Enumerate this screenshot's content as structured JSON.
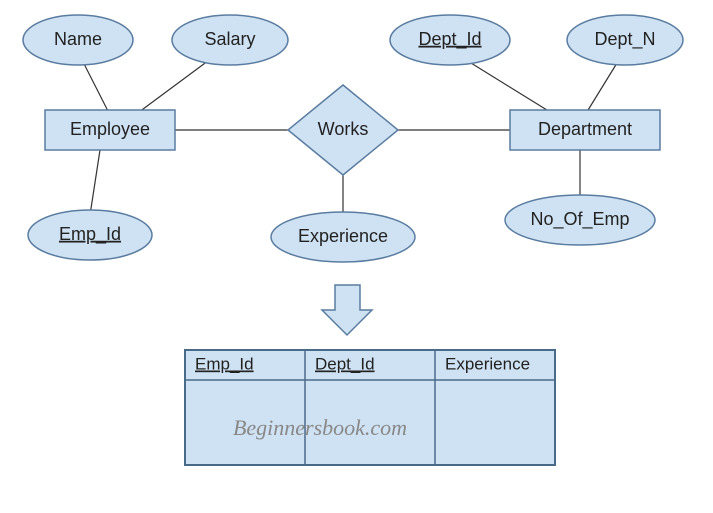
{
  "entities": {
    "employee": "Employee",
    "department": "Department"
  },
  "relationship": {
    "works": "Works"
  },
  "attributes": {
    "name": "Name",
    "salary": "Salary",
    "emp_id": "Emp_Id",
    "experience": "Experience",
    "dept_id": "Dept_Id",
    "dept_n": "Dept_N",
    "no_of_emp": "No_Of_Emp"
  },
  "table": {
    "col1": "Emp_Id",
    "col2": "Dept_Id",
    "col3": "Experience"
  },
  "watermark": "Beginnersbook.com"
}
